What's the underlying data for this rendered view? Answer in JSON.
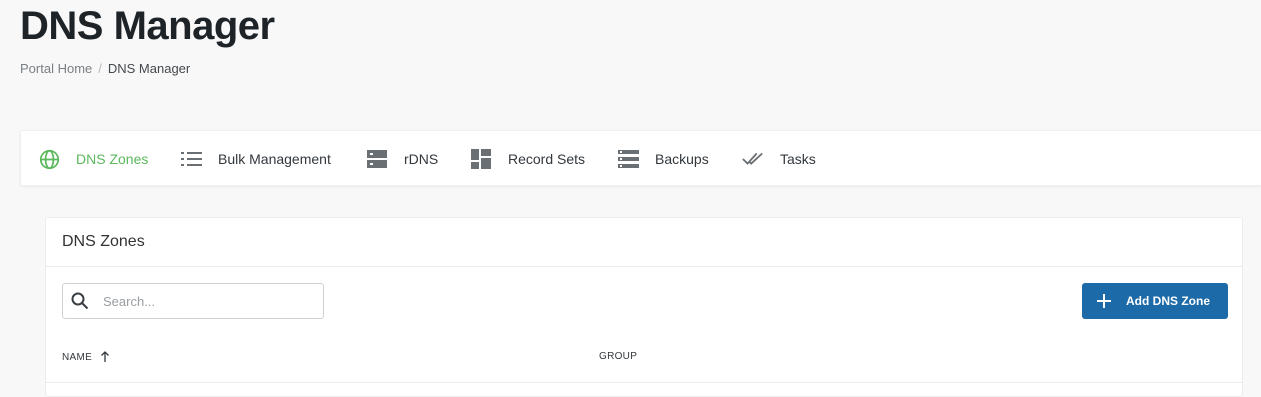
{
  "page": {
    "title": "DNS Manager"
  },
  "breadcrumb": {
    "items": [
      {
        "label": "Portal Home"
      },
      {
        "label": "DNS Manager"
      }
    ],
    "separator": "/"
  },
  "tabs": [
    {
      "label": "DNS Zones",
      "icon": "globe-icon",
      "active": true
    },
    {
      "label": "Bulk Management",
      "icon": "list-icon",
      "active": false
    },
    {
      "label": "rDNS",
      "icon": "server-icon",
      "active": false
    },
    {
      "label": "Record Sets",
      "icon": "dashboard-grid-icon",
      "active": false
    },
    {
      "label": "Backups",
      "icon": "storage-icon",
      "active": false
    },
    {
      "label": "Tasks",
      "icon": "double-check-icon",
      "active": false
    }
  ],
  "card": {
    "title": "DNS Zones",
    "search": {
      "placeholder": "Search...",
      "value": ""
    },
    "add_button": {
      "label": "Add DNS Zone"
    },
    "columns": [
      {
        "label": "NAME",
        "sort": "ascending"
      },
      {
        "label": "GROUP"
      }
    ]
  },
  "colors": {
    "accent_active": "#5cb85c",
    "primary_button": "#1d6aa9",
    "icon_gray": "#6a6f74"
  }
}
